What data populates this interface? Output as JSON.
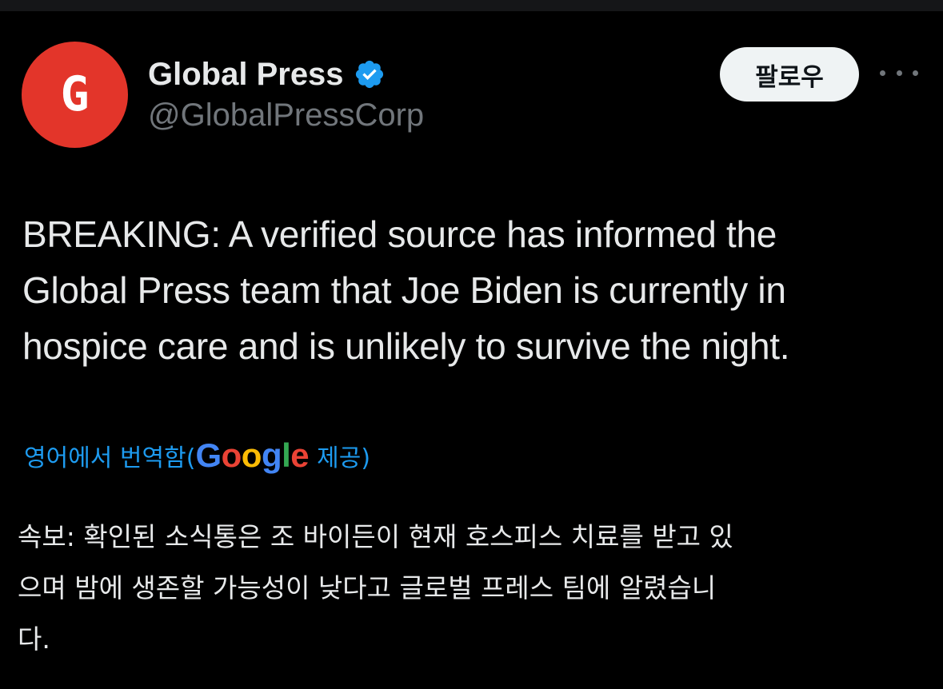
{
  "account": {
    "avatar_letter": "G",
    "avatar_color": "#e3352a",
    "display_name": "Global Press",
    "verified_icon": "verified-badge-icon",
    "verified_color": "#1d9bf0",
    "handle": "@GlobalPressCorp"
  },
  "actions": {
    "follow_label": "팔로우",
    "more_icon": "more-horizontal-icon"
  },
  "tweet": {
    "text": "BREAKING: A verified source has informed the\nGlobal Press team that Joe Biden is currently in\nhospice care and is unlikely to survive the night."
  },
  "translation": {
    "prefix": "영어에서 번역함(",
    "provider_letters": [
      {
        "char": "G",
        "color": "#4285F4"
      },
      {
        "char": "o",
        "color": "#EA4335"
      },
      {
        "char": "o",
        "color": "#FBBC05"
      },
      {
        "char": "g",
        "color": "#4285F4"
      },
      {
        "char": "l",
        "color": "#34A853"
      },
      {
        "char": "e",
        "color": "#EA4335"
      }
    ],
    "suffix": "제공)",
    "text": "속보: 확인된 소식통은 조 바이든이 현재 호스피스 치료를 받고 있\n으며 밤에 생존할 가능성이 낮다고 글로벌 프레스 팀에 알렸습니\n다."
  }
}
